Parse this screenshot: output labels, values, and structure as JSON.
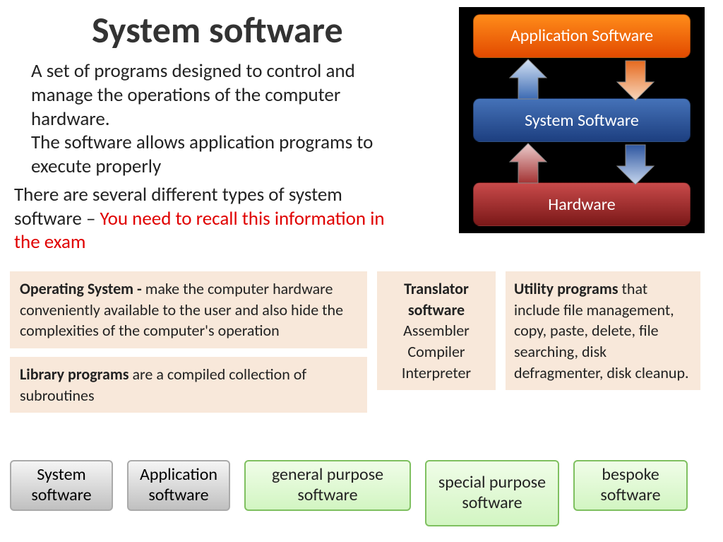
{
  "title": "System software",
  "intro_p1": "A set of programs designed to control and manage the operations of the computer hardware.",
  "intro_p2": "The software allows application programs to execute properly",
  "types_black": "There are several different types of system software – ",
  "types_red": "You need to recall this information in the exam",
  "diagram": {
    "app": "Application Software",
    "sys": "System Software",
    "hw": "Hardware"
  },
  "cards": {
    "os_bold": "Operating System - ",
    "os_rest": "make the computer hardware conveniently available to the user and also hide the complexities of the computer's operation",
    "lib_bold": "Library programs ",
    "lib_rest": "are a compiled collection of subroutines",
    "trans_title": "Translator software",
    "trans_l1": "Assembler",
    "trans_l2": "Compiler",
    "trans_l3": "Interpreter",
    "util_bold": "Utility programs ",
    "util_rest": "that include file management, copy, paste, delete, file searching, disk defragmenter, disk cleanup."
  },
  "buttons": {
    "b1": "System software",
    "b2": "Application software",
    "b3": "general purpose software",
    "b4": "special purpose software",
    "b5": "bespoke software"
  }
}
